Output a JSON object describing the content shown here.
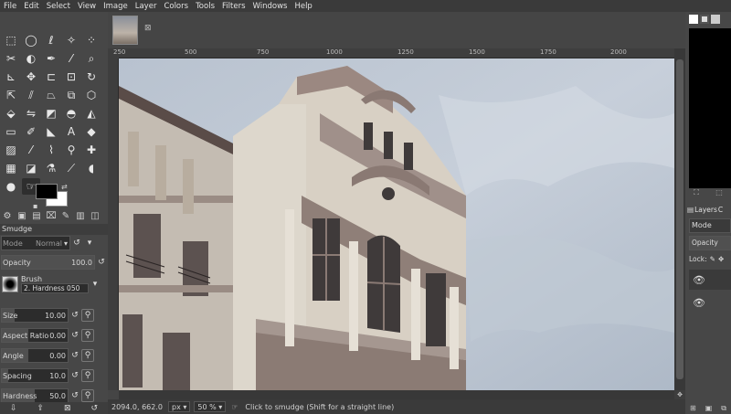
{
  "menubar": {
    "items": [
      "File",
      "Edit",
      "Select",
      "View",
      "Image",
      "Layer",
      "Colors",
      "Tools",
      "Filters",
      "Windows",
      "Help"
    ]
  },
  "ruler": {
    "labels": [
      "250",
      "500",
      "750",
      "1000",
      "1250",
      "1500",
      "1750",
      "2000"
    ]
  },
  "toolbox": {
    "tools": [
      "rect-select-icon",
      "ellipse-select-icon",
      "free-select-icon",
      "fuzzy-select-icon",
      "scissors-icon",
      "foreground-select-icon",
      "paths-icon",
      "color-picker-icon",
      "move-icon",
      "alignment-icon",
      "crop-icon",
      "zoom-icon",
      "unified-transform-icon",
      "rotate-icon",
      "scale-icon",
      "shear-icon",
      "flip-icon",
      "handle-transform-icon",
      "cage-icon",
      "3d-transform-icon",
      "warp-icon",
      "perspective-icon",
      "text-icon",
      "bucket-fill-icon",
      "gradient-icon",
      "pencil-icon",
      "paintbrush-icon",
      "eraser-icon",
      "airbrush-icon",
      "ink-icon",
      "mypaint-icon",
      "clone-icon",
      "heal-icon",
      "perspective-clone-icon",
      "blur-icon",
      "smudge-icon",
      "dodge-icon",
      "smudge-active-icon",
      "burn-icon"
    ]
  },
  "tool_options": {
    "title": "Smudge",
    "mode_label": "Mode",
    "mode_value": "Normal",
    "opacity_label": "Opacity",
    "opacity_value": "100.0",
    "brush_label": "Brush",
    "brush_value": "2. Hardness 050",
    "size_label": "Size",
    "size_value": "10.00",
    "aspect_label": "Aspect Ratio",
    "aspect_value": "0.00",
    "angle_label": "Angle",
    "angle_value": "0.00",
    "spacing_label": "Spacing",
    "spacing_value": "10.0",
    "hardness_label": "Hardness",
    "hardness_value": "50.0"
  },
  "statusbar": {
    "coords": "2094.0, 662.0",
    "unit": "px",
    "zoom": "50 %",
    "message": "Click to smudge (Shift for a straight line)"
  },
  "right_panel": {
    "layers_tab": "Layers",
    "channels_tab": "C",
    "mode_label": "Mode",
    "opacity_label": "Opacity",
    "lock_label": "Lock:"
  }
}
